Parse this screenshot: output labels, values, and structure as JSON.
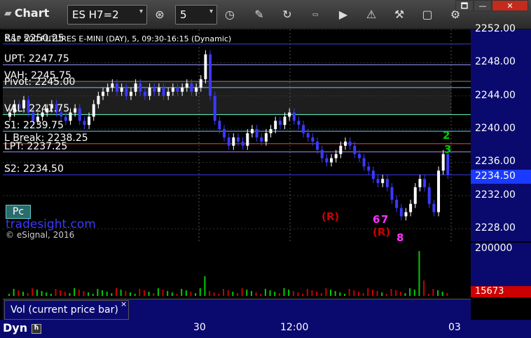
{
  "toolbar": {
    "title": "Chart",
    "symbol": "ES H7=2",
    "interval": "5",
    "buttons": [
      "link-icon",
      "clock-icon",
      "pencil-icon",
      "refresh-icon",
      "get-icon",
      "play-icon",
      "alert-icon",
      "tools-icon",
      "comment-icon",
      "settings-icon"
    ]
  },
  "window": {
    "restore": "🗖",
    "minimize": "—",
    "close": "✕"
  },
  "chart": {
    "header": "S&P 500 FUTURES E-MINI (DAY), 5, 09:30-16:15 (Dynamic)",
    "header_overlay": "R1: 2250.25",
    "levels": [
      {
        "label": "R1: 2250.25",
        "price": 2250.25,
        "color": "#3a3af0"
      },
      {
        "label": "UPT: 2247.75",
        "price": 2247.75,
        "color": "#9999ff"
      },
      {
        "label": "VAH: 2245.75",
        "price": 2245.75,
        "color": "#888888"
      },
      {
        "label": "Pivot: 2245.00",
        "price": 2245.0,
        "color": "#66ccff"
      },
      {
        "label": "VAL: 2241.75",
        "price": 2241.75,
        "color": "#66ffcc"
      },
      {
        "label": "S1: 2239.75",
        "price": 2239.75,
        "color": "#66ccff"
      },
      {
        "label": "L Break: 2238.25",
        "price": 2238.25,
        "color": "#ff4444"
      },
      {
        "label": "LPT: 2237.25",
        "price": 2237.25,
        "color": "#aa88ff"
      },
      {
        "label": "S2: 2234.50",
        "price": 2234.5,
        "color": "#3a3af0"
      }
    ],
    "price_ticks": [
      "2252.00",
      "2248.00",
      "2244.00",
      "2240.00",
      "2236.00",
      "2232.00",
      "2228.00"
    ],
    "current_price": "2234.50",
    "pc_label": "Pc",
    "watermark": "tradesight.com",
    "copyright": "© eSignal, 2016",
    "annotations": [
      {
        "text": "(R)",
        "color": "#cc0000"
      },
      {
        "text": "(R)",
        "color": "#cc0000"
      },
      {
        "text": "2",
        "color": "#00cc00"
      },
      {
        "text": "3",
        "color": "#00cc00"
      },
      {
        "text": "6",
        "color": "#ff33ff"
      },
      {
        "text": "7",
        "color": "#ff33ff"
      },
      {
        "text": "8",
        "color": "#ff33ff"
      }
    ]
  },
  "volume": {
    "ticks": [
      "200000"
    ],
    "current": "15673",
    "legend": "Vol (current price bar)",
    "close": "×"
  },
  "time_axis": {
    "labels": [
      "30",
      "12:00",
      "03"
    ],
    "dyn_label": "Dyn"
  },
  "colors": {
    "up": "#ffffff",
    "down": "#3a3aff",
    "axis_bg": "#0a0a6e",
    "current_price_bg": "#1a3aff",
    "current_vol_bg": "#cc0000"
  }
}
